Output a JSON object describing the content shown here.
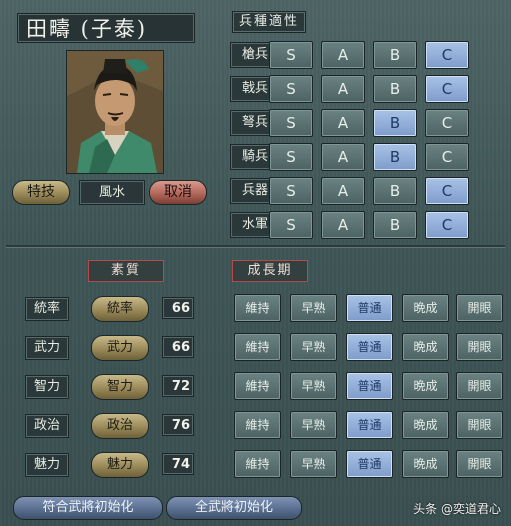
{
  "header": {
    "general_name": "田疇 (子泰)"
  },
  "specialty": {
    "button_label": "特技",
    "value": "風水",
    "cancel_label": "取消"
  },
  "arms": {
    "title": "兵種適性",
    "rows": [
      {
        "label": "槍兵",
        "selected": "C"
      },
      {
        "label": "戟兵",
        "selected": "C"
      },
      {
        "label": "弩兵",
        "selected": "B"
      },
      {
        "label": "騎兵",
        "selected": "B"
      },
      {
        "label": "兵器",
        "selected": "C"
      },
      {
        "label": "水軍",
        "selected": "C"
      }
    ],
    "grades": [
      "S",
      "A",
      "B",
      "C"
    ]
  },
  "quality": {
    "title": "素質",
    "growth_title": "成長期",
    "growth_options": [
      "維持",
      "早熟",
      "普通",
      "晩成",
      "開眼"
    ],
    "rows": [
      {
        "label": "統率",
        "button": "統率",
        "value": "66",
        "growth_selected": "普通"
      },
      {
        "label": "武力",
        "button": "武力",
        "value": "66",
        "growth_selected": "普通"
      },
      {
        "label": "智力",
        "button": "智力",
        "value": "72",
        "growth_selected": "普通"
      },
      {
        "label": "政治",
        "button": "政治",
        "value": "76",
        "growth_selected": "普通"
      },
      {
        "label": "魅力",
        "button": "魅力",
        "value": "74",
        "growth_selected": "普通"
      }
    ]
  },
  "footer": {
    "reset_matching_label": "符合武將初始化",
    "reset_all_label": "全武將初始化",
    "watermark": "头条 @奕道君心"
  },
  "colors": {
    "background": "#3f5152",
    "selected_grade": "#8fb0dd",
    "accent_red": "#b44a4a",
    "gold_button": "#9a8a5a"
  }
}
